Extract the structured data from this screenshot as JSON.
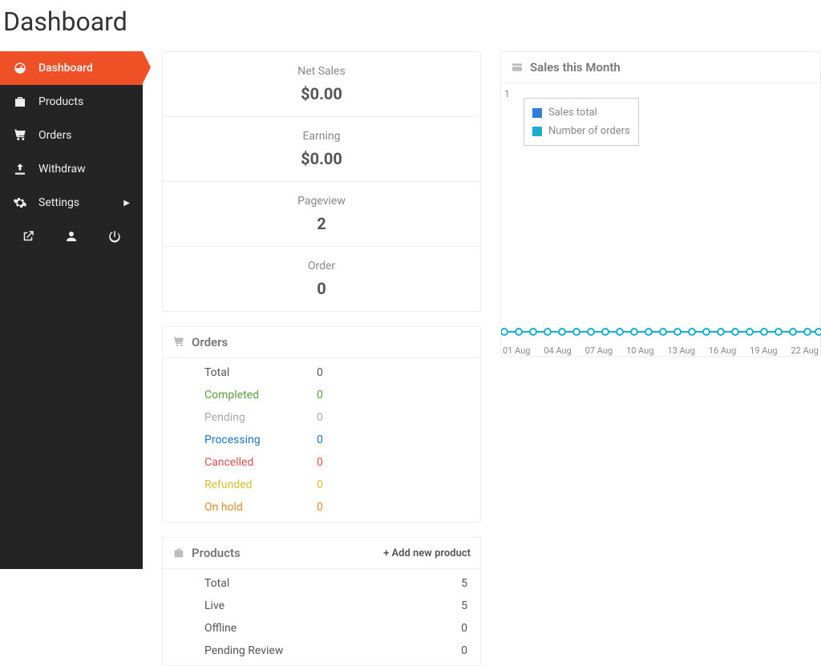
{
  "page_title": "Dashboard",
  "sidebar": {
    "items": {
      "dashboard": "Dashboard",
      "products": "Products",
      "orders": "Orders",
      "withdraw": "Withdraw",
      "settings": "Settings"
    }
  },
  "stats": {
    "net_sales_label": "Net Sales",
    "net_sales_value": "$0.00",
    "earning_label": "Earning",
    "earning_value": "$0.00",
    "pageview_label": "Pageview",
    "pageview_value": "2",
    "order_label": "Order",
    "order_value": "0"
  },
  "orders_panel": {
    "title": "Orders",
    "rows": {
      "total_label": "Total",
      "total_val": "0",
      "completed_label": "Completed",
      "completed_val": "0",
      "pending_label": "Pending",
      "pending_val": "0",
      "processing_label": "Processing",
      "processing_val": "0",
      "cancelled_label": "Cancelled",
      "cancelled_val": "0",
      "refunded_label": "Refunded",
      "refunded_val": "0",
      "onhold_label": "On hold",
      "onhold_val": "0"
    }
  },
  "products_panel": {
    "title": "Products",
    "add_link": "+ Add new product",
    "rows": {
      "total_label": "Total",
      "total_val": "5",
      "live_label": "Live",
      "live_val": "5",
      "offline_label": "Offline",
      "offline_val": "0",
      "pending_label": "Pending Review",
      "pending_val": "0"
    }
  },
  "chart": {
    "title": "Sales this Month",
    "y_tick": "1",
    "legend": {
      "sales_total": "Sales total",
      "num_orders": "Number of orders"
    },
    "xaxis": [
      "01 Aug",
      "04 Aug",
      "07 Aug",
      "10 Aug",
      "13 Aug",
      "16 Aug",
      "19 Aug",
      "22 Aug"
    ]
  },
  "chart_data": {
    "type": "line",
    "title": "Sales this Month",
    "x": [
      "01 Aug",
      "02 Aug",
      "03 Aug",
      "04 Aug",
      "05 Aug",
      "06 Aug",
      "07 Aug",
      "08 Aug",
      "09 Aug",
      "10 Aug",
      "11 Aug",
      "12 Aug",
      "13 Aug",
      "14 Aug",
      "15 Aug",
      "16 Aug",
      "17 Aug",
      "18 Aug",
      "19 Aug",
      "20 Aug",
      "21 Aug",
      "22 Aug",
      "23 Aug"
    ],
    "series": [
      {
        "name": "Sales total",
        "values": [
          0,
          0,
          0,
          0,
          0,
          0,
          0,
          0,
          0,
          0,
          0,
          0,
          0,
          0,
          0,
          0,
          0,
          0,
          0,
          0,
          0,
          0,
          0
        ]
      },
      {
        "name": "Number of orders",
        "values": [
          0,
          0,
          0,
          0,
          0,
          0,
          0,
          0,
          0,
          0,
          0,
          0,
          0,
          0,
          0,
          0,
          0,
          0,
          0,
          0,
          0,
          0,
          0
        ]
      }
    ],
    "ylim": [
      0,
      1
    ],
    "xlabel": "",
    "ylabel": ""
  }
}
